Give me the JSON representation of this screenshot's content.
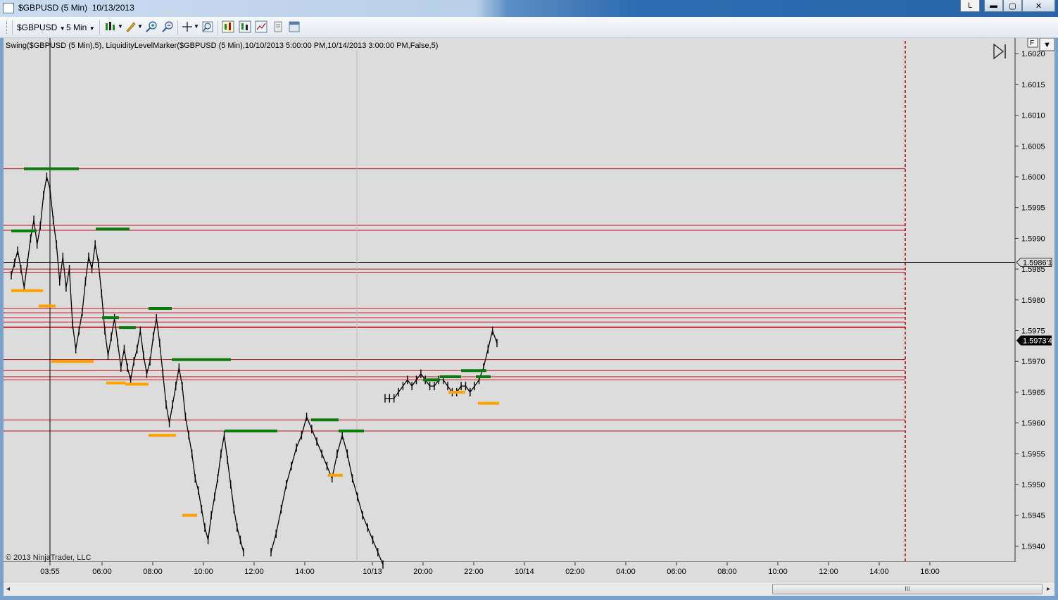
{
  "window": {
    "title": "$GBPUSD (5 Min)  10/13/2013",
    "lock_label": "L",
    "minimize_label": "▬",
    "maximize_label": "▢",
    "close_label": "✕"
  },
  "toolbar": {
    "instrument": "$GBPUSD",
    "interval": "5 Min",
    "icons": [
      "candlestick-icon",
      "pencil-icon",
      "zoom-in-icon",
      "zoom-out-icon",
      "crosshair-icon",
      "magnifier-icon",
      "bar-chart-icon",
      "indicators-icon",
      "strategies-icon",
      "properties-icon",
      "template-icon"
    ]
  },
  "chart": {
    "indicator_label": "Swing($GBPUSD (5 Min),5), LiquidityLevelMarker($GBPUSD (5 Min),10/10/2013 5:00:00 PM,10/14/2013 3:00:00 PM,False,5)",
    "copyright": "© 2013 NinjaTrader, LLC",
    "f_button": "F",
    "dropdown_label": "▼",
    "scroll_end_label": "▷|",
    "background": "#dcdcdc",
    "price_line_color": "#c0101c",
    "swing_high_color": "#0a7a0a",
    "swing_low_color": "#ffa200",
    "session_end_color": "#b00000",
    "current_price_label": "1.5973'4",
    "crosshair_price_label": "1.5986'1",
    "scrollbar_grip": "III"
  },
  "chart_data": {
    "type": "line",
    "title": "",
    "xlabel": "",
    "ylabel": "",
    "ylim": [
      1.5936,
      1.6022
    ],
    "x_ticks": [
      "03:55",
      "06:00",
      "08:00",
      "10:00",
      "12:00",
      "14:00",
      "10/13",
      "20:00",
      "22:00",
      "10/14",
      "02:00",
      "04:00",
      "06:00",
      "08:00",
      "10:00",
      "12:00",
      "14:00",
      "16:00"
    ],
    "y_ticks": [
      "1.6020",
      "1.6015",
      "1.6010",
      "1.6005",
      "1.6000",
      "1.5995",
      "1.5990",
      "1.5985",
      "1.5980",
      "1.5975",
      "1.5970",
      "1.5965",
      "1.5960",
      "1.5955",
      "1.5950",
      "1.5945",
      "1.5940"
    ],
    "liquidity_levels": [
      1.60013,
      1.59921,
      1.59913,
      1.5985,
      1.59845,
      1.59786,
      1.59779,
      1.59771,
      1.59764,
      1.59756,
      1.59755,
      1.59703,
      1.59685,
      1.59675,
      1.5967,
      1.59605,
      1.59587
    ],
    "swing_highs": [
      {
        "x_start": "02:25",
        "x_end": "03:25",
        "value": 1.59912
      },
      {
        "x_start": "02:55",
        "x_end": "05:05",
        "value": 1.60013
      },
      {
        "x_start": "05:45",
        "x_end": "07:05",
        "value": 1.59915
      },
      {
        "x_start": "06:00",
        "x_end": "06:40",
        "value": 1.59771
      },
      {
        "x_start": "06:40",
        "x_end": "07:20",
        "value": 1.59755
      },
      {
        "x_start": "07:50",
        "x_end": "08:45",
        "value": 1.59786
      },
      {
        "x_start": "08:45",
        "x_end": "11:05",
        "value": 1.59703
      },
      {
        "x_start": "10:50",
        "x_end": "12:55",
        "value": 1.59587
      },
      {
        "x_start": "14:15",
        "x_end": "15:20",
        "value": 1.59605
      },
      {
        "x_start": "15:20",
        "x_end": "16:20",
        "value": 1.59587
      },
      {
        "x_start": "18:00",
        "x_end": "18:40",
        "value": 1.5967
      },
      {
        "x_start": "18:40",
        "x_end": "19:30",
        "value": 1.59675
      },
      {
        "x_start": "19:30",
        "x_end": "20:30",
        "value": 1.59685
      },
      {
        "x_start": "20:05",
        "x_end": "20:40",
        "value": 1.59675
      }
    ],
    "swing_lows": [
      {
        "x_start": "02:25",
        "x_end": "03:40",
        "value": 1.59815
      },
      {
        "x_start": "03:30",
        "x_end": "04:10",
        "value": 1.5979
      },
      {
        "x_start": "04:00",
        "x_end": "05:40",
        "value": 1.597
      },
      {
        "x_start": "06:10",
        "x_end": "06:55",
        "value": 1.59665
      },
      {
        "x_start": "06:55",
        "x_end": "07:50",
        "value": 1.59663
      },
      {
        "x_start": "07:50",
        "x_end": "08:55",
        "value": 1.5958
      },
      {
        "x_start": "09:10",
        "x_end": "09:45",
        "value": 1.5945
      },
      {
        "x_start": "14:55",
        "x_end": "15:30",
        "value": 1.59515
      },
      {
        "x_start": "19:00",
        "x_end": "19:40",
        "value": 1.5965
      },
      {
        "x_start": "20:10",
        "x_end": "21:00",
        "value": 1.59632
      }
    ],
    "price_series": [
      {
        "name": "",
        "x_range": [
          "02:25",
          "11:35"
        ],
        "values": [
          1.5984,
          1.5986,
          1.5988,
          1.5985,
          1.5982,
          1.5986,
          1.599,
          1.5993,
          1.5989,
          1.5992,
          1.5997,
          1.6,
          1.5998,
          1.5993,
          1.5989,
          1.5983,
          1.5987,
          1.5982,
          1.5985,
          1.5976,
          1.5972,
          1.5975,
          1.5978,
          1.5983,
          1.5987,
          1.5985,
          1.5989,
          1.5986,
          1.5981,
          1.5975,
          1.5971,
          1.5974,
          1.5977,
          1.5973,
          1.5969,
          1.5972,
          1.5969,
          1.5967,
          1.597,
          1.5972,
          1.5975,
          1.5971,
          1.5968,
          1.597,
          1.5974,
          1.5977,
          1.5973,
          1.5968,
          1.5963,
          1.596,
          1.5963,
          1.5966,
          1.5969,
          1.5966,
          1.5961,
          1.5958,
          1.5955,
          1.5951,
          1.5949,
          1.5946,
          1.5943,
          1.5941,
          1.5945,
          1.5948,
          1.5951,
          1.5955,
          1.5958,
          1.5954,
          1.595,
          1.5946,
          1.5943,
          1.5941,
          1.5939
        ]
      },
      {
        "name": "",
        "x_range": [
          "12:40",
          "16:25"
        ],
        "values": [
          1.5939,
          1.5942,
          1.5946,
          1.595,
          1.5953,
          1.5956,
          1.5958,
          1.5961,
          1.5959,
          1.5957,
          1.5955,
          1.5953,
          1.5951,
          1.5955,
          1.5958,
          1.5955,
          1.5951,
          1.5948,
          1.5945,
          1.5943,
          1.5941,
          1.5939,
          1.5937
        ]
      },
      {
        "name": "",
        "x_range": [
          "16:30",
          "20:55"
        ],
        "values": [
          1.5964,
          1.5964,
          1.5964,
          1.5965,
          1.5966,
          1.5967,
          1.5966,
          1.5967,
          1.5968,
          1.5967,
          1.5966,
          1.5966,
          1.5967,
          1.5967,
          1.5966,
          1.5965,
          1.5965,
          1.5966,
          1.5966,
          1.5965,
          1.5966,
          1.5967,
          1.5969,
          1.5972,
          1.5975,
          1.5973
        ]
      }
    ],
    "session_end_x": "15:00",
    "crosshair_x": "03:55",
    "crosshair_y": 1.59861,
    "grid": false
  }
}
